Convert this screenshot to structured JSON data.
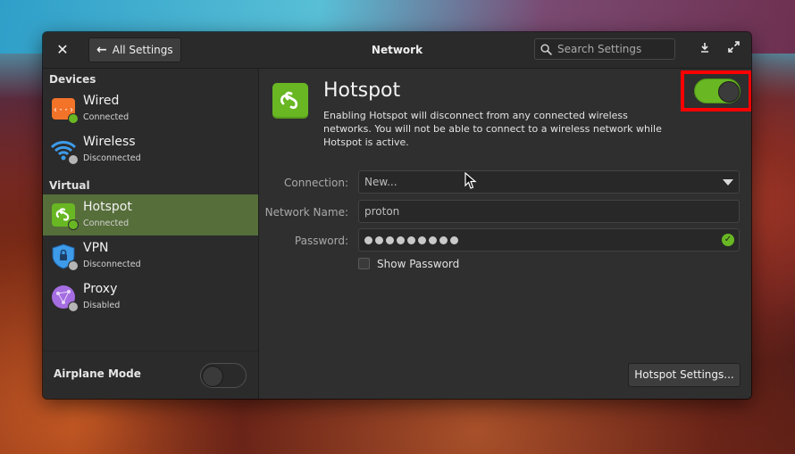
{
  "window": {
    "title": "Network",
    "back_label": "All Settings",
    "search_placeholder": "Search Settings"
  },
  "sidebar": {
    "sections": [
      {
        "label": "Devices"
      },
      {
        "label": "Virtual"
      }
    ],
    "items": [
      {
        "name": "Wired",
        "status": "Connected",
        "icon": "wired-network-icon",
        "status_color": "#68b723"
      },
      {
        "name": "Wireless",
        "status": "Disconnected",
        "icon": "wireless-icon",
        "status_color": "#b5b5b5"
      },
      {
        "name": "Hotspot",
        "status": "Connected",
        "icon": "hotspot-icon",
        "status_color": "#68b723",
        "selected": true
      },
      {
        "name": "VPN",
        "status": "Disconnected",
        "icon": "vpn-shield-icon",
        "status_color": "#b5b5b5"
      },
      {
        "name": "Proxy",
        "status": "Disabled",
        "icon": "proxy-globe-icon",
        "status_color": "#b5b5b5"
      }
    ],
    "airplane_mode": {
      "label": "Airplane Mode",
      "enabled": false
    }
  },
  "content": {
    "title": "Hotspot",
    "description": "Enabling Hotspot will disconnect from any connected wireless networks. You will not be able to connect to a wireless network while Hotspot is active.",
    "enabled": true,
    "form": {
      "connection_label": "Connection:",
      "connection_value": "New...",
      "network_name_label": "Network Name:",
      "network_name_value": "proton",
      "password_label": "Password:",
      "password_mask_count": 9,
      "show_password_label": "Show Password"
    },
    "settings_button": "Hotspot Settings..."
  },
  "colors": {
    "accent_green": "#68b723",
    "selected_row": "#566e3a",
    "highlight": "#ff0000"
  }
}
